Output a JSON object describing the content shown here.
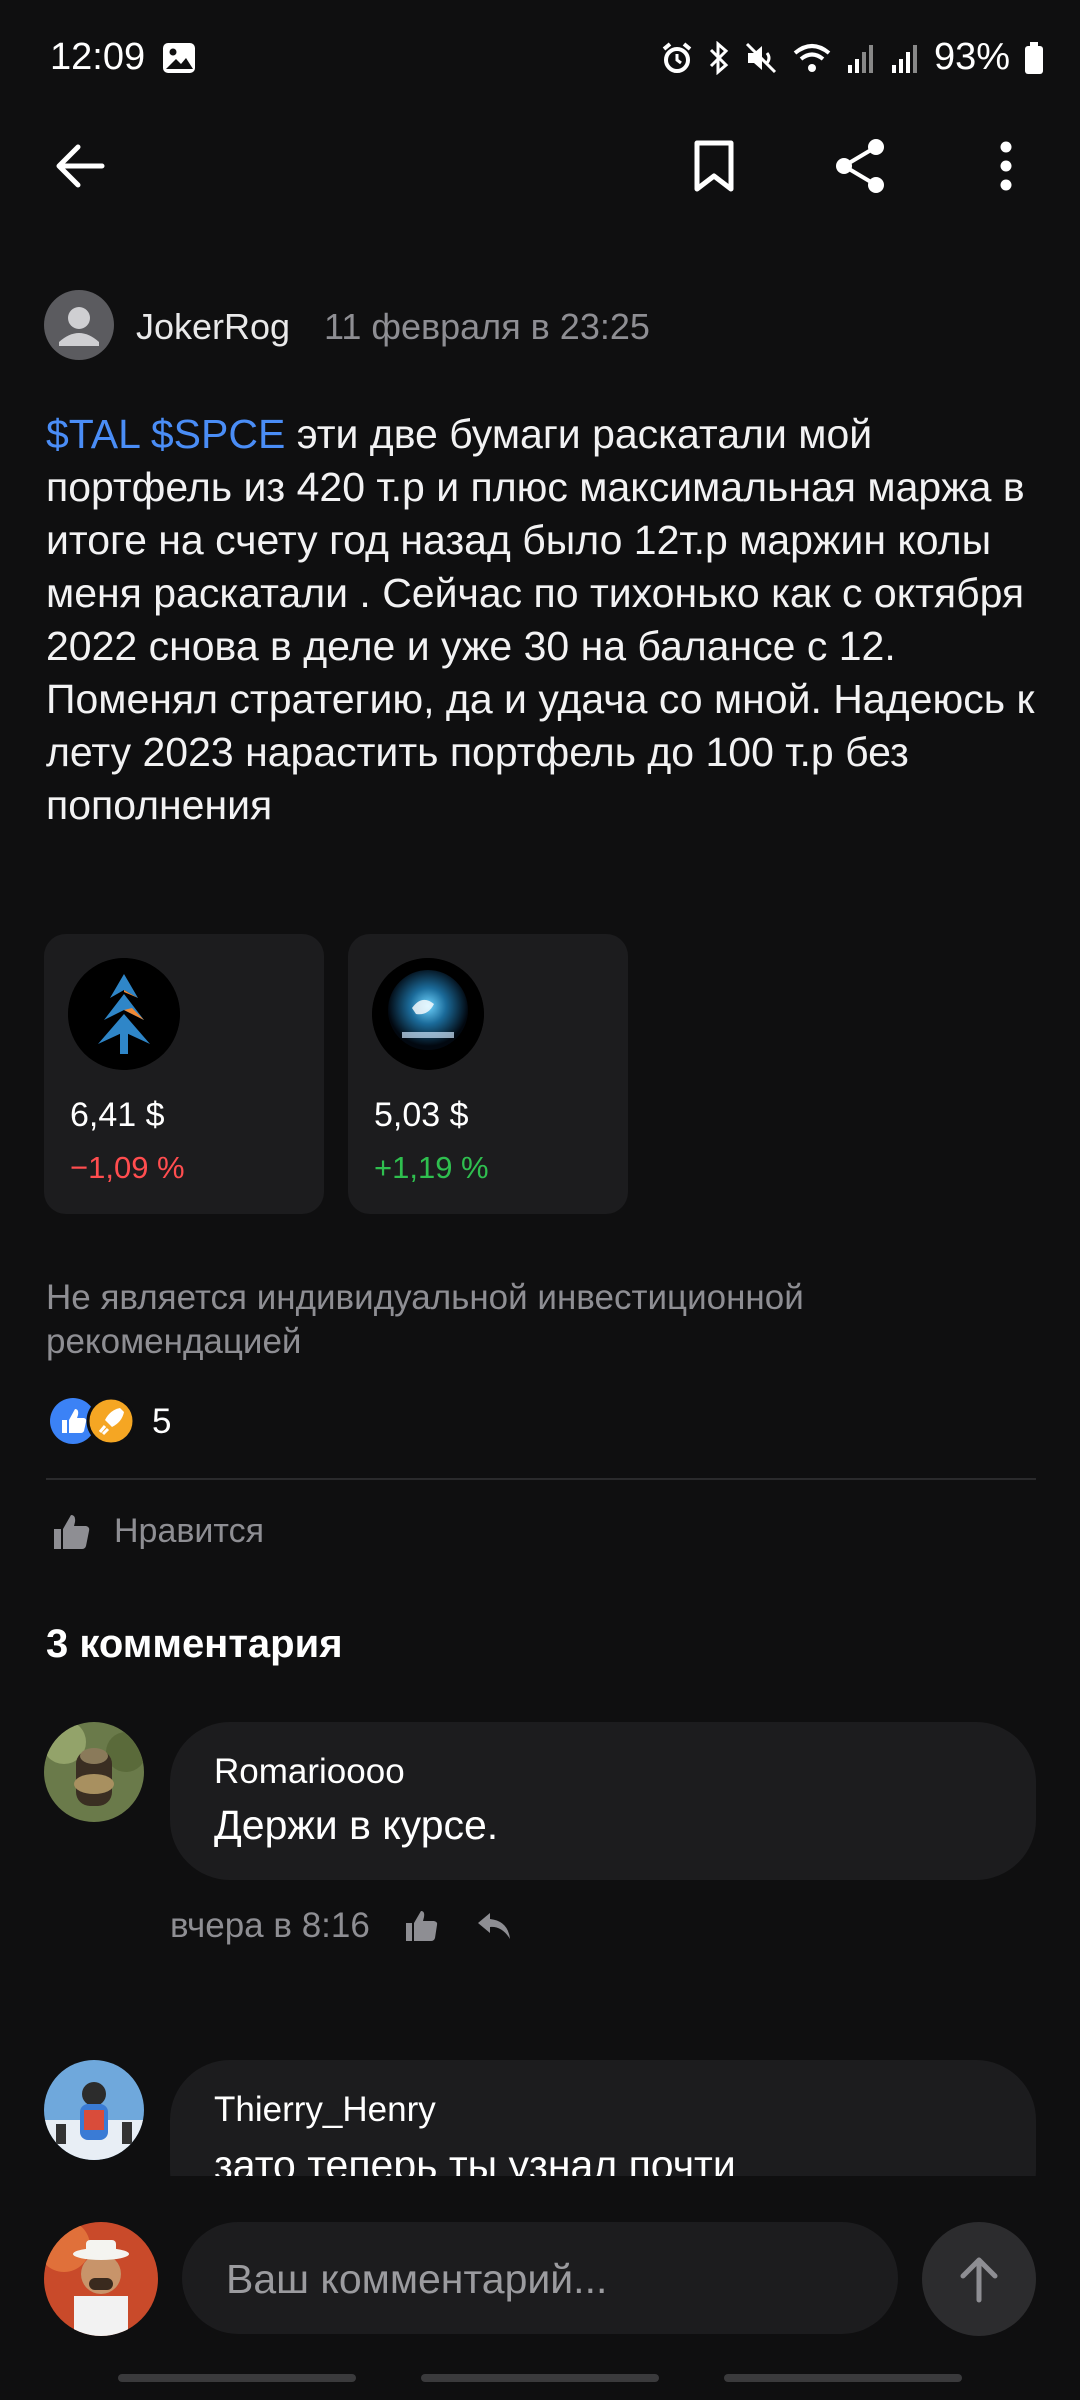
{
  "status_bar": {
    "time": "12:09",
    "battery": "93%"
  },
  "toolbar": {
    "back_icon": "arrow-left-icon",
    "bookmark_icon": "bookmark-icon",
    "share_icon": "share-icon",
    "more_icon": "more-vertical-icon"
  },
  "post": {
    "author": "JokerRog",
    "date": "11 февраля в 23:25",
    "tickers": [
      "$TAL",
      "$SPCE"
    ],
    "text": " эти две бумаги раскатали мой портфель из 420 т.р и плюс максимальная маржа в итоге на счету год назад было 12т.р маржин колы меня раскатали . Сейчас по тихонько как с октября 2022 снова в деле и уже 30 на балансе с 12. Поменял стратегию, да и удача со мной. Надеюсь к лету 2023 нарастить портфель  до 100 т.р без пополнения",
    "instruments": [
      {
        "price": "6,41  $",
        "change": "−1,09 %",
        "direction": "down"
      },
      {
        "price": "5,03  $",
        "change": "+1,19 %",
        "direction": "up"
      }
    ],
    "disclaimer": "Не является индивидуальной инвестиционной рекомендацией",
    "reactions_count": "5",
    "like_label": "Нравится"
  },
  "comments": {
    "heading": "3 комментария",
    "items": [
      {
        "author": "Romarioooo",
        "text": "Держи в курсе.",
        "time": "вчера в 8:16"
      },
      {
        "author": "Thierry_Henry",
        "text": "зато теперь ты узнал почти"
      }
    ]
  },
  "composer": {
    "placeholder": "Ваш комментарий..."
  },
  "colors": {
    "background": "#0f0f10",
    "ticker_link": "#4a8df6",
    "negative": "#ff4d4f",
    "positive": "#2fbf4f"
  }
}
